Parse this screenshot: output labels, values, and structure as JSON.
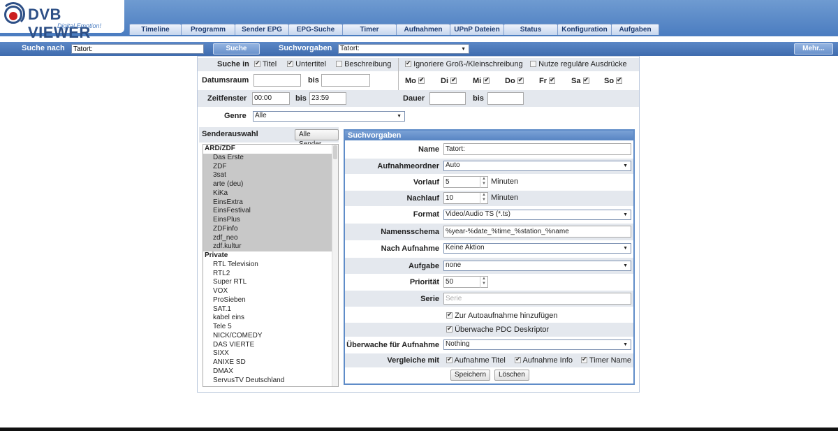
{
  "app": {
    "logo_main": "DVB VIEWER",
    "logo_sub": "Digital Emotion!"
  },
  "nav": {
    "tabs": [
      "Timeline",
      "Programm",
      "Sender EPG",
      "EPG-Suche",
      "Timer",
      "Aufnahmen",
      "UPnP Dateien",
      "Status",
      "Konfiguration",
      "Aufgaben"
    ]
  },
  "searchbar": {
    "label": "Suche nach",
    "value": "Tatort:",
    "button": "Suche",
    "presets_label": "Suchvorgaben",
    "presets_value": "Tatort:",
    "more_button": "Mehr..."
  },
  "filters": {
    "search_in_label": "Suche in",
    "titel": "Titel",
    "untertitel": "Untertitel",
    "beschreibung": "Beschreibung",
    "ignore_case": "Ignoriere Groß-/Kleinschreibung",
    "regex": "Nutze reguläre Ausdrücke",
    "date_range_label": "Datumsraum",
    "bis": "bis",
    "days": [
      "Mo",
      "Di",
      "Mi",
      "Do",
      "Fr",
      "Sa",
      "So"
    ],
    "time_window_label": "Zeitfenster",
    "time_from": "00:00",
    "time_to": "23:59",
    "duration_label": "Dauer",
    "genre_label": "Genre",
    "genre_value": "Alle"
  },
  "channels": {
    "label": "Senderauswahl",
    "all_button": "Alle Sender",
    "groups": [
      {
        "name": "ARD/ZDF",
        "items": [
          "Das Erste",
          "ZDF",
          "3sat",
          "arte (deu)",
          "KiKa",
          "EinsExtra",
          "EinsFestival",
          "EinsPlus",
          "ZDFinfo",
          "zdf_neo",
          "zdf.kultur"
        ]
      },
      {
        "name": "Private",
        "items": [
          "RTL Television",
          "RTL2",
          "Super RTL",
          "VOX",
          "ProSieben",
          "SAT.1",
          "kabel eins",
          "Tele 5",
          "NICK/COMEDY",
          "DAS VIERTE",
          "SIXX",
          "ANIXE SD",
          "DMAX",
          "ServusTV Deutschland"
        ]
      }
    ]
  },
  "presets": {
    "header": "Suchvorgaben",
    "name_label": "Name",
    "name_value": "Tatort:",
    "folder_label": "Aufnahmeordner",
    "folder_value": "Auto",
    "pre_label": "Vorlauf",
    "pre_value": "5",
    "minutes": "Minuten",
    "post_label": "Nachlauf",
    "post_value": "10",
    "format_label": "Format",
    "format_value": "Video/Audio TS (*.ts)",
    "naming_label": "Namensschema",
    "naming_value": "%year-%date_%time_%station_%name",
    "after_label": "Nach Aufnahme",
    "after_value": "Keine Aktion",
    "task_label": "Aufgabe",
    "task_value": "none",
    "priority_label": "Priorität",
    "priority_value": "50",
    "series_label": "Serie",
    "series_placeholder": "Serie",
    "auto_add": "Zur Autoaufnahme hinzufügen",
    "pdc": "Überwache PDC Deskriptor",
    "monitor_label": "Überwache für Aufnahme",
    "monitor_value": "Nothing",
    "compare_label": "Vergleiche mit",
    "compare_title": "Aufnahme Titel",
    "compare_info": "Aufnahme Info",
    "compare_timer": "Timer Name",
    "save_button": "Speichern",
    "delete_button": "Löschen"
  }
}
